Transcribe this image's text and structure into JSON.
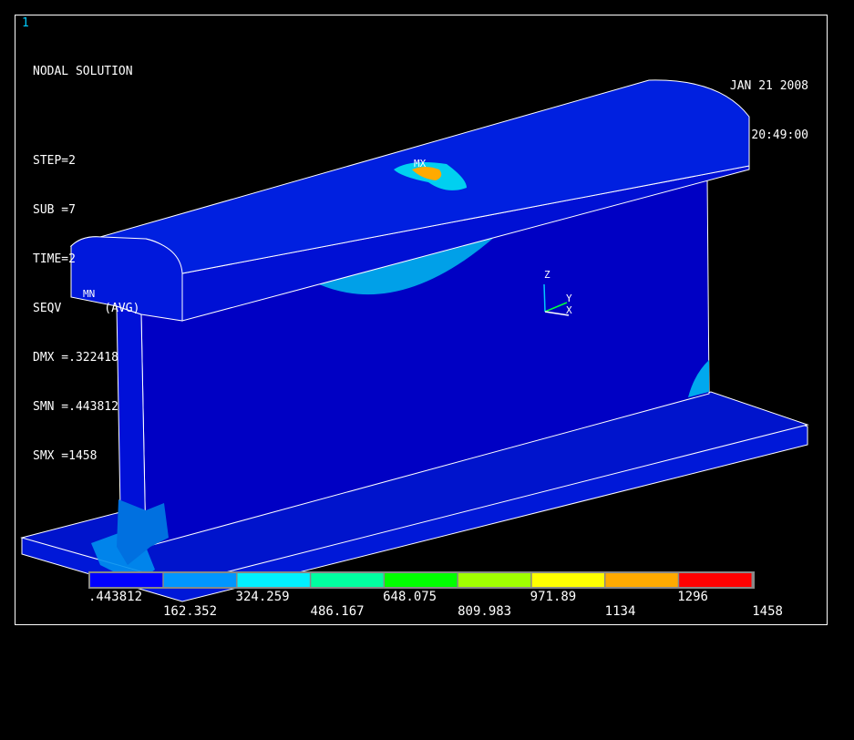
{
  "window_number": "1",
  "info": {
    "title": "NODAL SOLUTION",
    "step": "STEP=2",
    "sub": "SUB =7",
    "time": "TIME=2",
    "result": "SEQV      (AVG)",
    "dmx": "DMX =.322418",
    "smn": "SMN =.443812",
    "smx": "SMX =1458"
  },
  "date": "JAN 21 2008",
  "clock": "20:49:00",
  "markers": {
    "max": "MX",
    "min": "MN"
  },
  "triad": {
    "z": "Z",
    "y": "Y",
    "x": "X"
  },
  "colors": {
    "background": "#000000",
    "model_dark": "#0000b8",
    "model_mid": "#0a14d8",
    "band1": "#0030ff",
    "band2": "#00a0ff",
    "band3": "#00e8ff"
  },
  "colorbar": {
    "colors": [
      "#0000ff",
      "#0096ff",
      "#00f0ff",
      "#00ffa0",
      "#00ff00",
      "#a0ff00",
      "#ffff00",
      "#ffaa00",
      "#ff0000"
    ],
    "labels_top": [
      ".443812",
      "324.259",
      "648.075",
      "971.89",
      "1296"
    ],
    "labels_bottom": [
      "162.352",
      "486.167",
      "809.983",
      "1134",
      "1458"
    ]
  }
}
